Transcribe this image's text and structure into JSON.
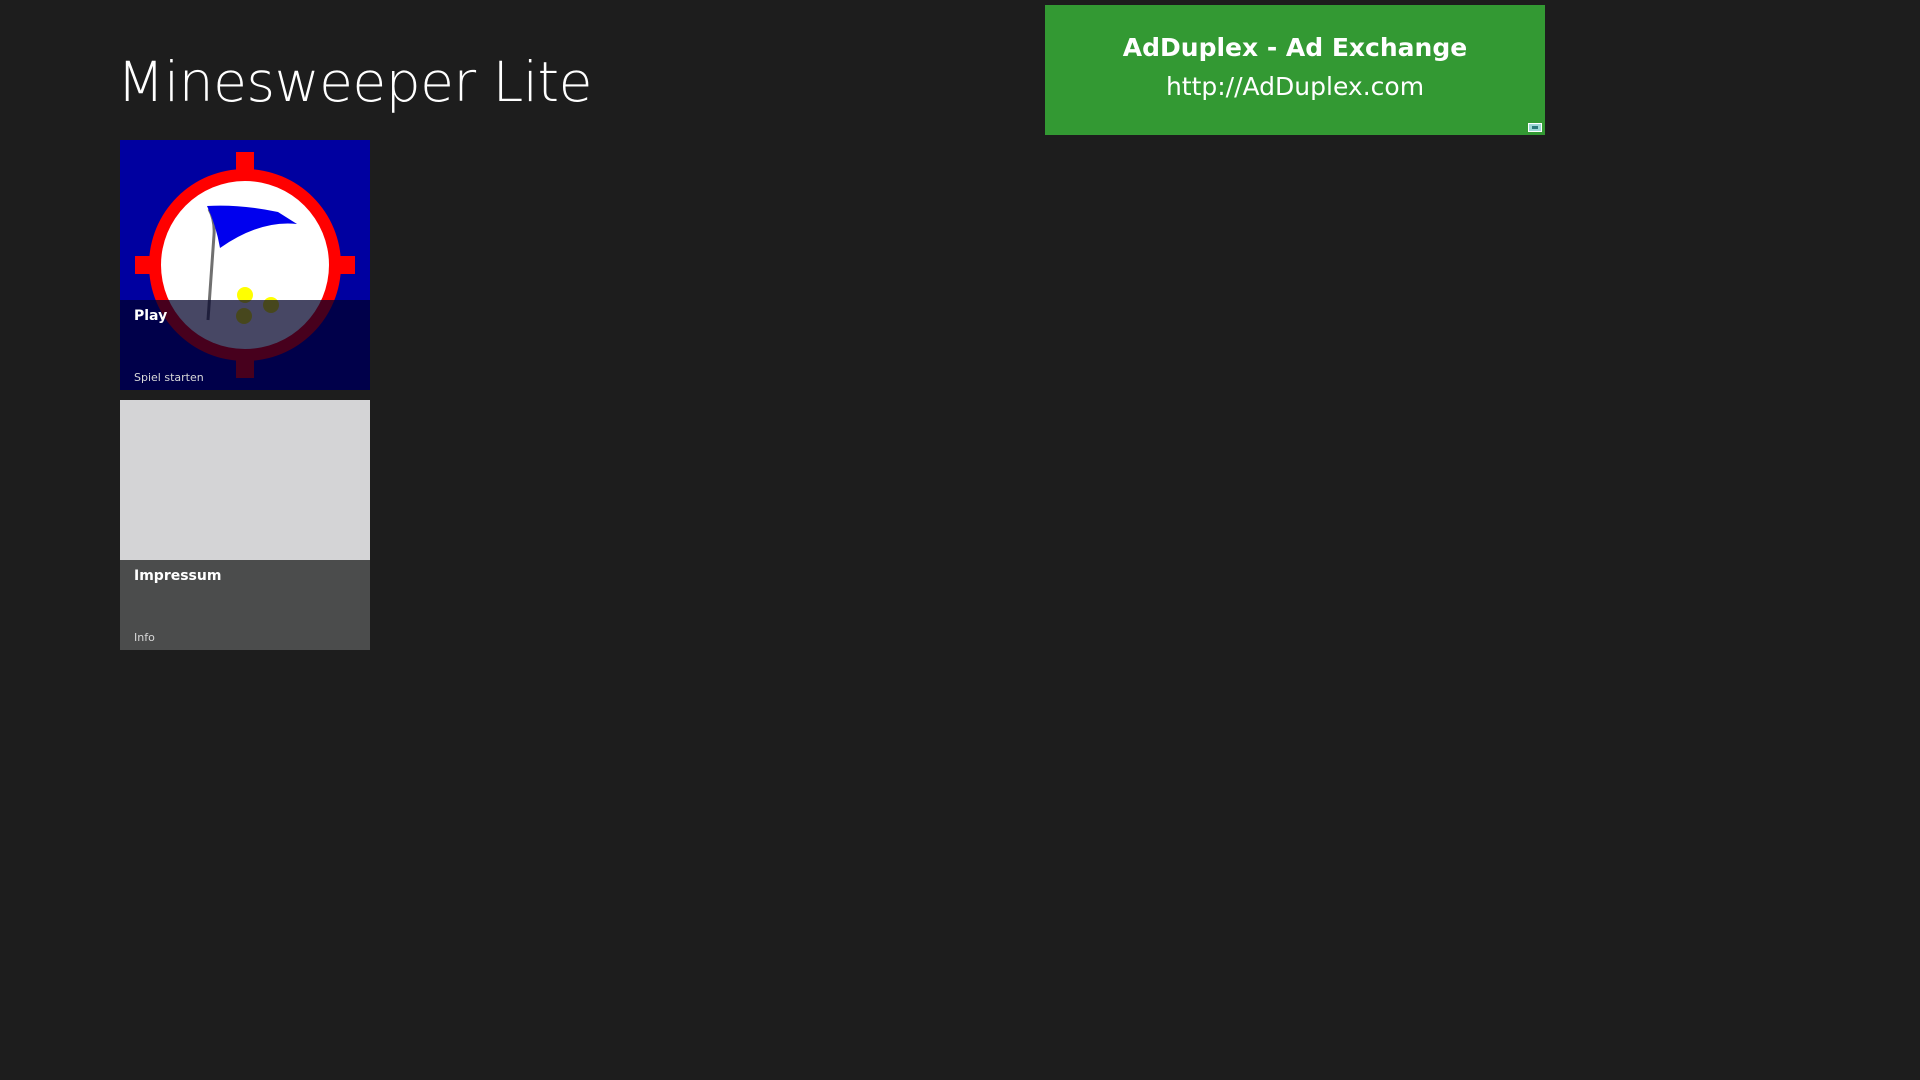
{
  "app": {
    "title": "Minesweeper Lite"
  },
  "tiles": [
    {
      "title": "Play",
      "subtitle": "Spiel starten",
      "icon": "minesweeper-flag-target-icon"
    },
    {
      "title": "Impressum",
      "subtitle": "Info",
      "icon": "blank-placeholder"
    }
  ],
  "ad": {
    "title": "AdDuplex - Ad Exchange",
    "url": "http://AdDuplex.com",
    "badge_icon": "adduplex-badge-icon",
    "color": "#339933"
  },
  "colors": {
    "background": "#1d1d1d",
    "play_tile": "#0000a0",
    "impressum_tile": "#d4d4d6",
    "impressum_caption": "#4b4c4c",
    "target_ring": "#ff0000",
    "flag": "#0000ff"
  }
}
